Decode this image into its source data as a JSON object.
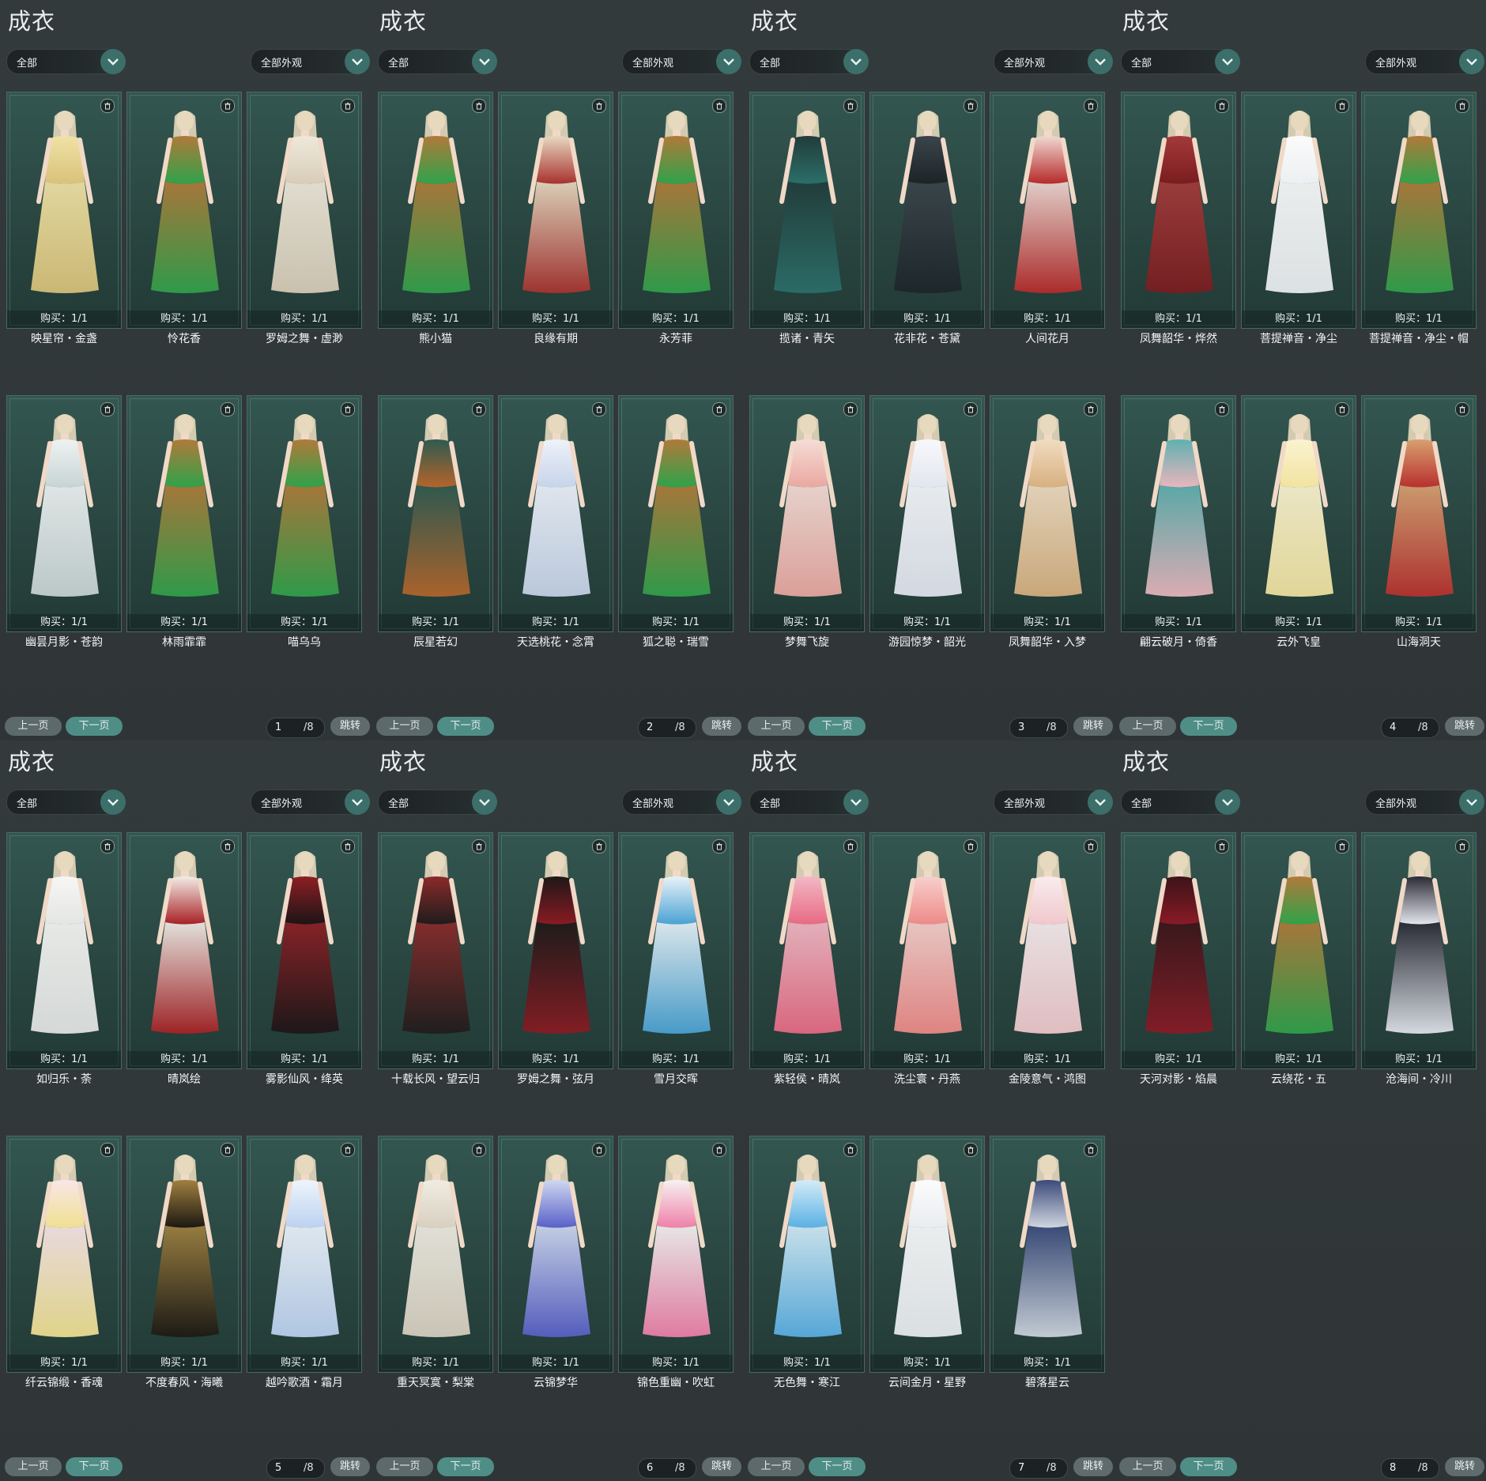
{
  "panels": [
    {
      "title": "成衣",
      "filter_category": "全部",
      "filter_appearance": "全部外观",
      "page": "1",
      "total": "/8",
      "prev_label": "上一页",
      "next_label": "下一页",
      "jump_label": "跳转",
      "items": [
        {
          "name": "映星帘・金盏",
          "buy": "购买：1/1",
          "palette": [
            "#d9c27a",
            "#f0e2a5"
          ]
        },
        {
          "name": "怜花香",
          "buy": "购买：1/1",
          "palette": [
            "#2fa24a",
            "#b07a3a"
          ]
        },
        {
          "name": "罗姆之舞・虚渺",
          "buy": "购买：1/1",
          "palette": [
            "#d8cdb8",
            "#efe8da"
          ]
        },
        {
          "name": "幽昙月影・苍韵",
          "buy": "购买：1/1",
          "palette": [
            "#c8d4d4",
            "#eef2f2"
          ]
        },
        {
          "name": "林雨霏霏",
          "buy": "购买：1/1",
          "palette": [
            "#2fa24a",
            "#b07a3a"
          ]
        },
        {
          "name": "喵乌乌",
          "buy": "购买：1/1",
          "palette": [
            "#2fa24a",
            "#b07a3a"
          ]
        }
      ]
    },
    {
      "title": "成衣",
      "filter_category": "全部",
      "filter_appearance": "全部外观",
      "page": "2",
      "total": "/8",
      "prev_label": "上一页",
      "next_label": "下一页",
      "jump_label": "跳转",
      "items": [
        {
          "name": "熊小猫",
          "buy": "购买：1/1",
          "palette": [
            "#2fa24a",
            "#b07a3a"
          ]
        },
        {
          "name": "良缘有期",
          "buy": "购买：1/1",
          "palette": [
            "#a8322e",
            "#e8d8c0"
          ]
        },
        {
          "name": "永芳菲",
          "buy": "购买：1/1",
          "palette": [
            "#2fa24a",
            "#b07a3a"
          ]
        },
        {
          "name": "辰星若幻",
          "buy": "购买：1/1",
          "palette": [
            "#b5652a",
            "#2f5a50"
          ]
        },
        {
          "name": "天选桃花・念霄",
          "buy": "购买：1/1",
          "palette": [
            "#c7d4ea",
            "#eef2fa"
          ]
        },
        {
          "name": "狐之聪・瑞雪",
          "buy": "购买：1/1",
          "palette": [
            "#2fa24a",
            "#b07a3a"
          ]
        }
      ]
    },
    {
      "title": "成衣",
      "filter_category": "全部",
      "filter_appearance": "全部外观",
      "page": "3",
      "total": "/8",
      "prev_label": "上一页",
      "next_label": "下一页",
      "jump_label": "跳转",
      "items": [
        {
          "name": "揽诸・青矢",
          "buy": "购买：1/1",
          "palette": [
            "#2c6f6a",
            "#213c3a"
          ]
        },
        {
          "name": "花非花・苍黛",
          "buy": "购买：1/1",
          "palette": [
            "#1d2428",
            "#3a444a"
          ]
        },
        {
          "name": "人间花月",
          "buy": "购买：1/1",
          "palette": [
            "#b62a2a",
            "#f0d8d2"
          ]
        },
        {
          "name": "梦舞飞旋",
          "buy": "购买：1/1",
          "palette": [
            "#e9a8a0",
            "#f6dcd6"
          ]
        },
        {
          "name": "游园惊梦・韶光",
          "buy": "购买：1/1",
          "palette": [
            "#e2e6f0",
            "#f7f8fb"
          ]
        },
        {
          "name": "凤舞韶华・入梦",
          "buy": "购买：1/1",
          "palette": [
            "#d8b080",
            "#f0dcc0"
          ]
        }
      ]
    },
    {
      "title": "成衣",
      "filter_category": "全部",
      "filter_appearance": "全部外观",
      "page": "4",
      "total": "/8",
      "prev_label": "上一页",
      "next_label": "下一页",
      "jump_label": "跳转",
      "items": [
        {
          "name": "凤舞韶华・烨然",
          "buy": "购买：1/1",
          "palette": [
            "#7a1c1f",
            "#a33a3a"
          ]
        },
        {
          "name": "菩提禅音・净尘",
          "buy": "购买：1/1",
          "palette": [
            "#eceff1",
            "#fbfbfb"
          ]
        },
        {
          "name": "菩提禅音・净尘・帽",
          "buy": "购买：1/1",
          "palette": [
            "#2fa24a",
            "#b07a3a"
          ]
        },
        {
          "name": "翩云破月・倚香",
          "buy": "购买：1/1",
          "palette": [
            "#e9b6bd",
            "#5fb0b0"
          ]
        },
        {
          "name": "云外飞皇",
          "buy": "购买：1/1",
          "palette": [
            "#f1e3a0",
            "#fbf3d0"
          ]
        },
        {
          "name": "山海洞天",
          "buy": "购买：1/1",
          "palette": [
            "#b8302e",
            "#d8a070"
          ]
        }
      ]
    },
    {
      "title": "成衣",
      "filter_category": "全部",
      "filter_appearance": "全部外观",
      "page": "5",
      "total": "/8",
      "prev_label": "上一页",
      "next_label": "下一页",
      "jump_label": "跳转",
      "items": [
        {
          "name": "如归乐・荼",
          "buy": "购买：1/1",
          "palette": [
            "#e4e6e4",
            "#f6f6f4"
          ]
        },
        {
          "name": "晴岚绘",
          "buy": "购买：1/1",
          "palette": [
            "#a82024",
            "#f2ece6"
          ]
        },
        {
          "name": "雾影仙风・绛英",
          "buy": "购买：1/1",
          "palette": [
            "#1c1416",
            "#8d1f24"
          ]
        },
        {
          "name": "纤云锦缎・香魂",
          "buy": "购买：1/1",
          "palette": [
            "#f0e090",
            "#f8e6e8"
          ]
        },
        {
          "name": "不度春风・海曦",
          "buy": "购买：1/1",
          "palette": [
            "#1c1812",
            "#a08040"
          ]
        },
        {
          "name": "越吟歌酒・霜月",
          "buy": "购买：1/1",
          "palette": [
            "#bcd2f0",
            "#eef4fc"
          ]
        }
      ]
    },
    {
      "title": "成衣",
      "filter_category": "全部",
      "filter_appearance": "全部外观",
      "page": "6",
      "total": "/8",
      "prev_label": "上一页",
      "next_label": "下一页",
      "jump_label": "跳转",
      "items": [
        {
          "name": "十载长风・望云归",
          "buy": "购买：1/1",
          "palette": [
            "#1f1c1c",
            "#8a2a2a"
          ]
        },
        {
          "name": "罗姆之舞・弦月",
          "buy": "购买：1/1",
          "palette": [
            "#8a1a22",
            "#1e1818"
          ]
        },
        {
          "name": "雪月交晖",
          "buy": "购买：1/1",
          "palette": [
            "#4aa2d4",
            "#e8f2f8"
          ]
        },
        {
          "name": "重天冥寞・梨棠",
          "buy": "购买：1/1",
          "palette": [
            "#d8d0c0",
            "#f0ece2"
          ]
        },
        {
          "name": "云锦梦华",
          "buy": "购买：1/1",
          "palette": [
            "#5860c8",
            "#d0d8f0"
          ]
        },
        {
          "name": "锦色重幽・吹虹",
          "buy": "购买：1/1",
          "palette": [
            "#ef80a8",
            "#f6f2f2"
          ]
        }
      ]
    },
    {
      "title": "成衣",
      "filter_category": "全部",
      "filter_appearance": "全部外观",
      "page": "7",
      "total": "/8",
      "prev_label": "上一页",
      "next_label": "下一页",
      "jump_label": "跳转",
      "items": [
        {
          "name": "紫轻侯・晴岚",
          "buy": "购买：1/1",
          "palette": [
            "#e86a84",
            "#f2b8c4"
          ]
        },
        {
          "name": "洗尘寰・丹燕",
          "buy": "购买：1/1",
          "palette": [
            "#ee8a88",
            "#f7cfcc"
          ]
        },
        {
          "name": "金陵意气・鸿图",
          "buy": "购买：1/1",
          "palette": [
            "#f0c8cc",
            "#f8ecee"
          ]
        },
        {
          "name": "无色舞・寒江",
          "buy": "购买：1/1",
          "palette": [
            "#5ab0e4",
            "#d4ecf8"
          ]
        },
        {
          "name": "云间金月・星野",
          "buy": "购买：1/1",
          "palette": [
            "#eaedf0",
            "#fafbfc"
          ]
        },
        {
          "name": "碧落星云",
          "buy": "购买：1/1",
          "palette": [
            "#d0d6e0",
            "#3a4a7a"
          ]
        }
      ]
    },
    {
      "title": "成衣",
      "filter_category": "全部",
      "filter_appearance": "全部外观",
      "page": "8",
      "total": "/8",
      "prev_label": "上一页",
      "next_label": "下一页",
      "jump_label": "跳转",
      "items": [
        {
          "name": "天河对影・焰晨",
          "buy": "购买：1/1",
          "palette": [
            "#8a1a26",
            "#3a1418"
          ]
        },
        {
          "name": "云绕花・五",
          "buy": "购买：1/1",
          "palette": [
            "#2fa24a",
            "#b07a3a"
          ]
        },
        {
          "name": "沧海间・冷川",
          "buy": "购买：1/1",
          "palette": [
            "#e4e6ee",
            "#2a2a34"
          ]
        }
      ]
    }
  ]
}
